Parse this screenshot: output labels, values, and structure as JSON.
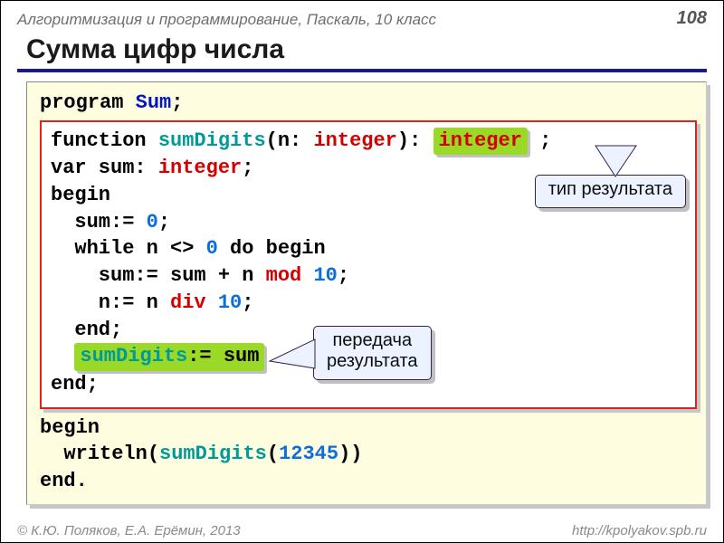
{
  "header": {
    "course": "Алгоритмизация и программирование, Паскаль, 10 класс",
    "page": "108"
  },
  "title": "Сумма цифр числа",
  "outerTop": {
    "program_kw": "program ",
    "program_name": "Sum",
    "semicolon": ";"
  },
  "inner": {
    "l1": {
      "function_kw": "function ",
      "fname": "sumDigits",
      "lparen": "(n: ",
      "ptype": "integer",
      "rparen": "):",
      "space": " ",
      "rtype": "integer",
      "after": " ;"
    },
    "l2": {
      "var_kw": "var sum: ",
      "type": "integer",
      "semi": ";"
    },
    "l3": "begin",
    "l4": {
      "pre": "  sum:= ",
      "zero": "0",
      "semi": ";"
    },
    "l5": {
      "pre": "  while n <> ",
      "zero": "0",
      "do_kw": " do begin"
    },
    "l6": {
      "pre": "    sum:= sum + n ",
      "mod": "mod",
      "sp": " ",
      "ten": "10",
      "semi": ";"
    },
    "l7": {
      "pre": "    n:= n ",
      "div": "div",
      "sp": " ",
      "ten": "10",
      "semi": ";"
    },
    "l8": "  end;",
    "l9": {
      "fn": "sumDigits",
      "assign": ":= sum"
    },
    "l10": "end;"
  },
  "outerBottom": {
    "begin": "begin",
    "write_pre": "  writeln(",
    "write_fn": "sumDigits",
    "lp": "(",
    "arg": "12345",
    "rp": "))",
    "end": "end."
  },
  "callouts": {
    "typeResult": "тип результата",
    "passResult_l1": "передача",
    "passResult_l2": "результата"
  },
  "footer": {
    "authors": "© К.Ю. Поляков, Е.А. Ерёмин, 2013",
    "url": "http://kpolyakov.spb.ru"
  }
}
